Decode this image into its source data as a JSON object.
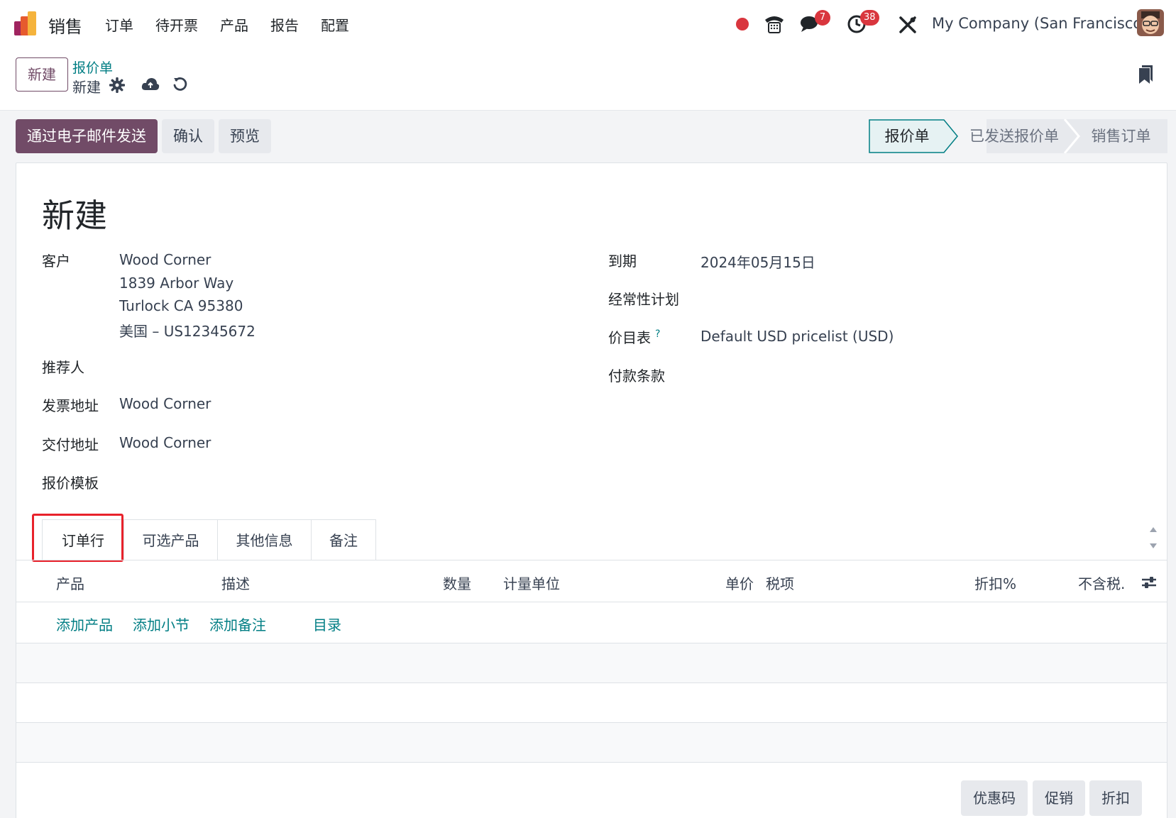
{
  "nav": {
    "app_name": "销售",
    "menu": [
      "订单",
      "待开票",
      "产品",
      "报告",
      "配置"
    ],
    "messages_count": "7",
    "activities_count": "38",
    "company": "My Company (San Francisco)"
  },
  "control": {
    "new_button": "新建",
    "breadcrumb_parent": "报价单",
    "breadcrumb_current": "新建"
  },
  "actions": {
    "send_email": "通过电子邮件发送",
    "confirm": "确认",
    "preview": "预览"
  },
  "stages": [
    "报价单",
    "已发送报价单",
    "销售订单"
  ],
  "colors": {
    "primary": "#714b67",
    "link": "#017e84",
    "badge": "#d9363e",
    "highlight": "#e8222b"
  },
  "form": {
    "title": "新建",
    "customer_label": "客户",
    "customer_name": "Wood Corner",
    "customer_street": "1839 Arbor Way",
    "customer_city": "Turlock CA 95380",
    "customer_country_vat": "美国 – US12345672",
    "referrer_label": "推荐人",
    "invoice_address_label": "发票地址",
    "invoice_address": "Wood Corner",
    "delivery_address_label": "交付地址",
    "delivery_address": "Wood Corner",
    "quote_template_label": "报价模板",
    "expiration_label": "到期",
    "expiration": "2024年05月15日",
    "recurring_plan_label": "经常性计划",
    "pricelist_label": "价目表",
    "pricelist_help": "?",
    "pricelist": "Default USD pricelist (USD)",
    "payment_terms_label": "付款条款"
  },
  "tabs": [
    "订单行",
    "可选产品",
    "其他信息",
    "备注"
  ],
  "table": {
    "columns": [
      "产品",
      "描述",
      "数量",
      "计量单位",
      "单价",
      "税项",
      "折扣%",
      "不含税."
    ],
    "add_links": [
      "添加产品",
      "添加小节",
      "添加备注",
      "目录"
    ]
  },
  "footer_buttons": [
    "优惠码",
    "促销",
    "折扣"
  ]
}
